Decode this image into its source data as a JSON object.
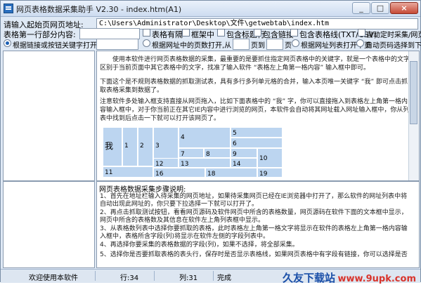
{
  "window": {
    "title": "网页表格数据采集助手 V2.30 - index.htm(A1)",
    "minimize": "_",
    "maximize": "□",
    "close": "×"
  },
  "url_row": {
    "label": "请输入起始页网页地址:",
    "value": "C:\\Users\\Administrator\\Desktop\\文件\\getwebtab\\index.htm"
  },
  "options_row": {
    "label": "表格第一行部分内容:",
    "input_value": "",
    "checkboxes": [
      {
        "label": "表格有隔"
      },
      {
        "label": "框架中"
      },
      {
        "label": "包含标题行"
      },
      {
        "label": "包含链接"
      },
      {
        "label": "包含表格线(TXT/CSV)"
      },
      {
        "label": "自动定时采集/网页加载"
      }
    ]
  },
  "mode_row": {
    "radio1": "根据链接或按钮关键字打开下页:",
    "radio2_prefix": "根据网址中的页数打开,从",
    "page_unit1": "页到",
    "page_unit2": "页",
    "radio3": "根据网址列表打开下页",
    "radio4": "自动页码选择到下页"
  },
  "content": {
    "para1": "使用本软件进行网页表格数据的采集，最重要的是要抓住指定网页表格中的关键字，就是一个表格中的文字区别于当前页面中其它表格中的文字，找准了输入软件 “表格左上角第一格内容” 输入框中即可。",
    "para2": "下面这个是不规则表格数据的抓取测试表，具有多行多列单元格的合并，输入本页唯一关键字 “我” 即可点击抓取表格采集到数据了。",
    "para3": "注意软件多处输入框支持直接从网页拖入，比如下面表格中的 “我” 字，你可以直接拖入到表格左上角第一格内容输入框中，对于你当前正在其它IE内容中进行浏览的网页，本软件会自动将其网址载入网址输入框中，你从列表中找到后点击一下就可以打开该网页了。",
    "table_cells": [
      "我",
      "1",
      "2",
      "3",
      "4",
      "5",
      "6",
      "7",
      "8",
      "9",
      "10",
      "12",
      "13",
      "14",
      "16",
      "18",
      "19",
      "11"
    ]
  },
  "instructions": {
    "heading": "网页表格数据采集步骤说明:",
    "steps": [
      "1、首先在地址栏输入待采集的网页地址，如果待采集网页已经在IE浏览器中打开了，那么软件的网址列表中将自动出现此网址的，你只要下拉选择一下就可以打开了。",
      "2、再点击抓取测试按钮，看看网页源码及软件网页中所含的表格数量，网页源码在软件下面的文本框中显示，网页中所含的表格数及其信息在软件左上角列表框中显示。",
      "3、从表格数列表中选择你要抓取的表格，此时表格左上角第一格文字将显示在软件的表格左上角第一格内容输入框中，表格所含字段(列)将显示在软件左侧的字段列表中。",
      "4、再选择你要采集的表格数据的字段(列)，如果不选择，将全部采集。",
      "5、选择你是否要抓取表格的表头行，保存时是否显示表格线，如果网页表格中有字段有链接，你可以选择是否"
    ]
  },
  "statusbar": {
    "welcome": "欢迎使用本软件",
    "row": "行:34",
    "col": "列:31",
    "state": "完成"
  },
  "watermark": {
    "brand": "久友下载站",
    "site": "www.9upk.com"
  }
}
